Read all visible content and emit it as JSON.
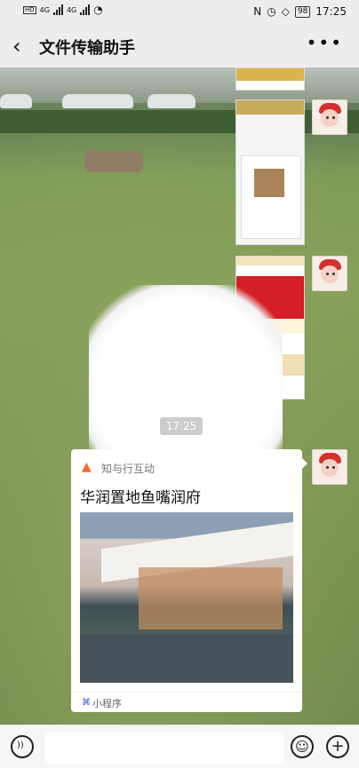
{
  "status": {
    "network_left": "4G",
    "network_right": "4G",
    "battery": "98",
    "time": "17:25"
  },
  "header": {
    "title": "文件传输助手",
    "more": "•••"
  },
  "chat": {
    "timestamp": "17:25",
    "card": {
      "app_name": "知与行互动",
      "title": "华润置地鱼嘴润府",
      "footer_label": "小程序"
    }
  },
  "input": {
    "placeholder": ""
  },
  "icons": [
    "back-icon",
    "signal-icon",
    "wifi-icon",
    "battery-icon",
    "more-icon",
    "voice-icon",
    "emoji-icon",
    "plus-icon"
  ],
  "colors": {
    "background": "#ededed",
    "grass": "#7e9b56",
    "card_accent": "#ff6532",
    "mini_program": "#2a56d6"
  }
}
